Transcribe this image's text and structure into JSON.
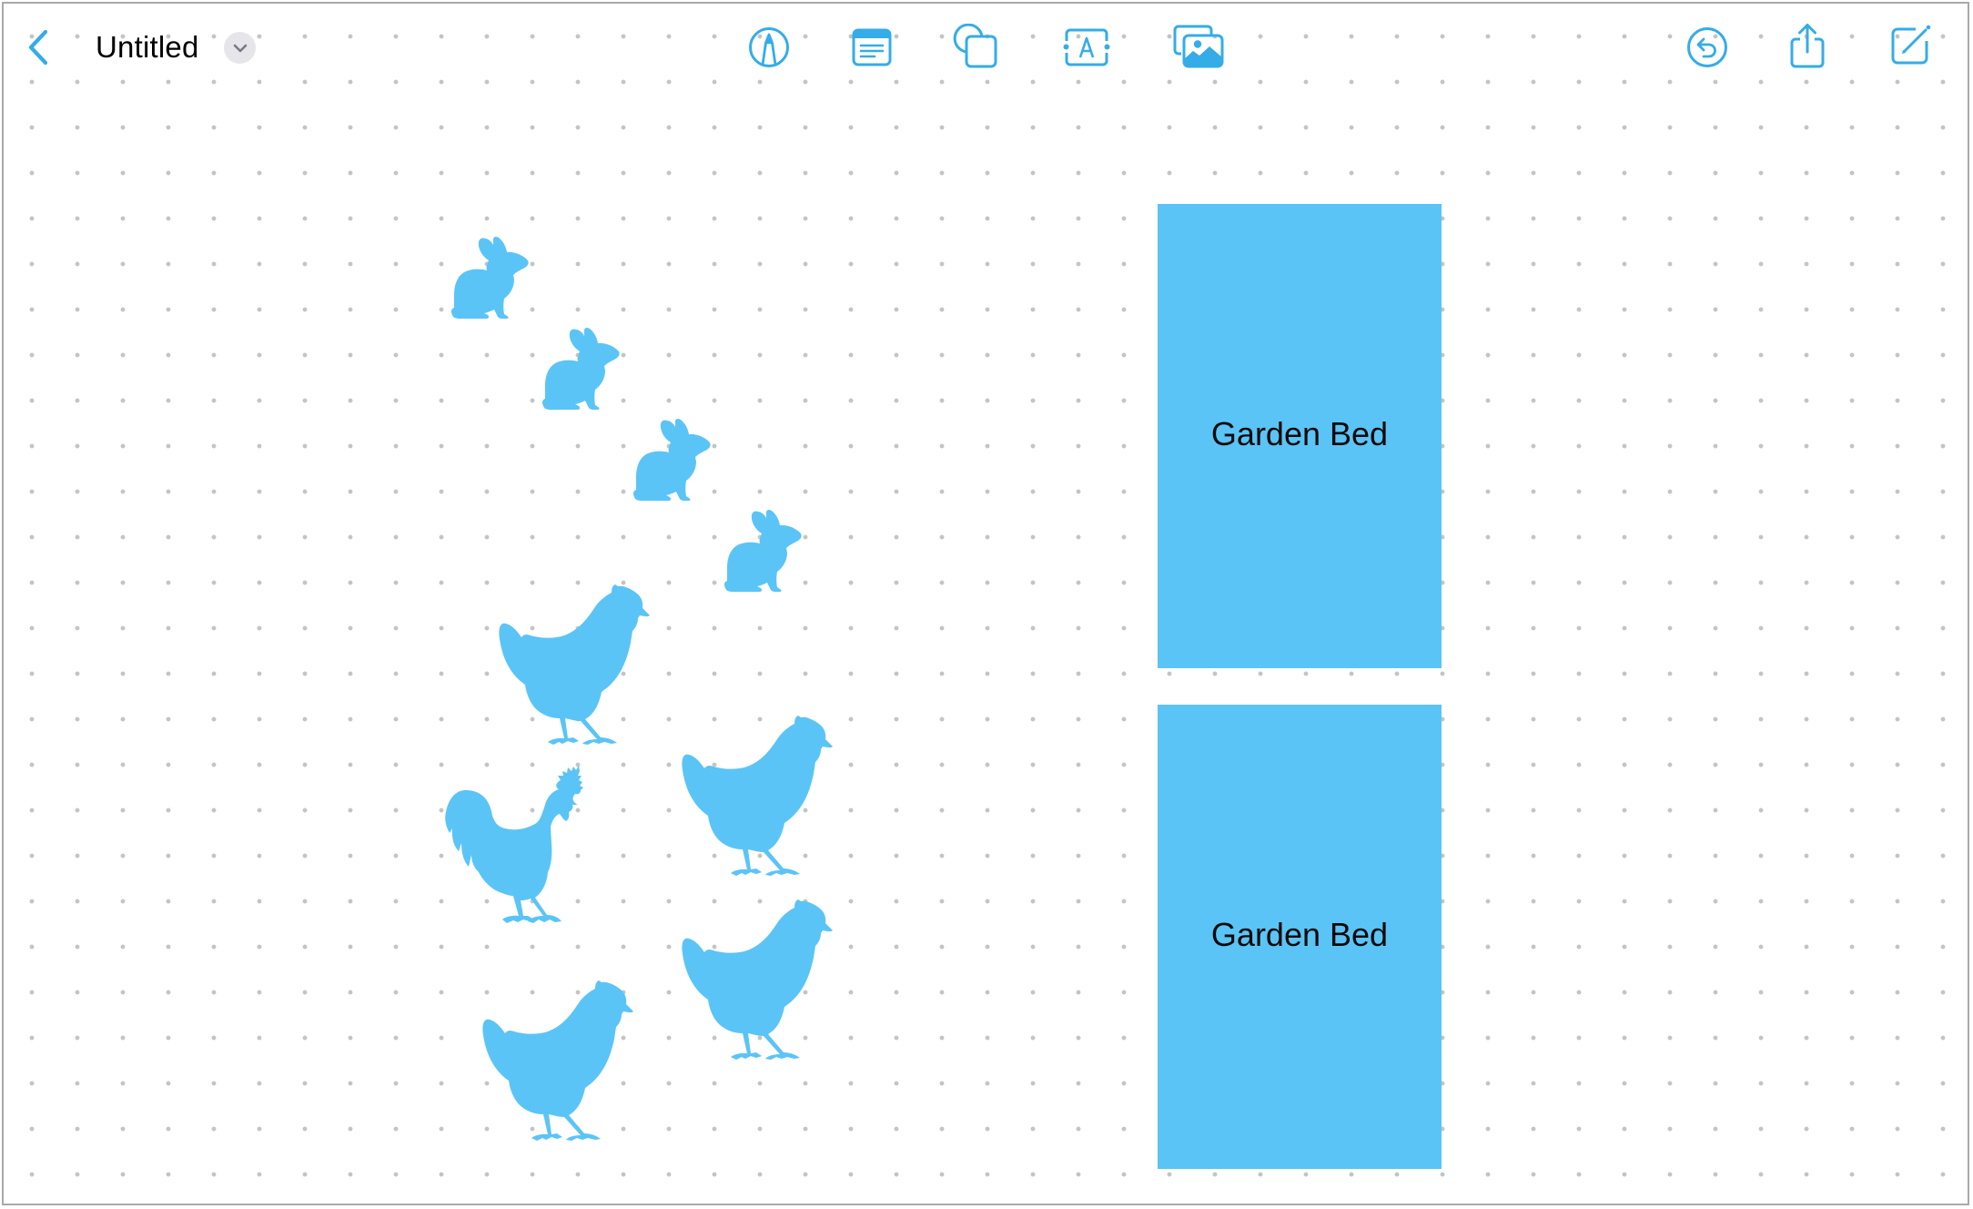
{
  "app": {
    "title": "Untitled",
    "accent_color": "#34ace8",
    "shape_color": "#5bc4f6"
  },
  "toolbar": {
    "left": [
      {
        "name": "back",
        "icon": "chevron-left-icon"
      },
      {
        "name": "title-menu",
        "icon": "chevron-down-icon"
      }
    ],
    "center": [
      {
        "name": "pen-tool",
        "icon": "pen-circle-icon"
      },
      {
        "name": "sticky-note",
        "icon": "note-icon"
      },
      {
        "name": "shapes",
        "icon": "shapes-icon"
      },
      {
        "name": "text-box",
        "icon": "text-box-icon"
      },
      {
        "name": "media",
        "icon": "photo-stack-icon"
      }
    ],
    "right": [
      {
        "name": "undo",
        "icon": "undo-circle-icon"
      },
      {
        "name": "share",
        "icon": "share-icon"
      },
      {
        "name": "new-board",
        "icon": "compose-icon"
      }
    ]
  },
  "board": {
    "background": "dot-grid",
    "items": [
      {
        "type": "rabbit",
        "label": "rabbit"
      },
      {
        "type": "rabbit",
        "label": "rabbit"
      },
      {
        "type": "rabbit",
        "label": "rabbit"
      },
      {
        "type": "rabbit",
        "label": "rabbit"
      },
      {
        "type": "hen",
        "label": "hen"
      },
      {
        "type": "hen",
        "label": "hen"
      },
      {
        "type": "rooster",
        "label": "rooster"
      },
      {
        "type": "hen",
        "label": "hen"
      },
      {
        "type": "hen",
        "label": "hen"
      }
    ],
    "garden_beds": [
      {
        "label": "Garden Bed"
      },
      {
        "label": "Garden Bed"
      }
    ]
  }
}
